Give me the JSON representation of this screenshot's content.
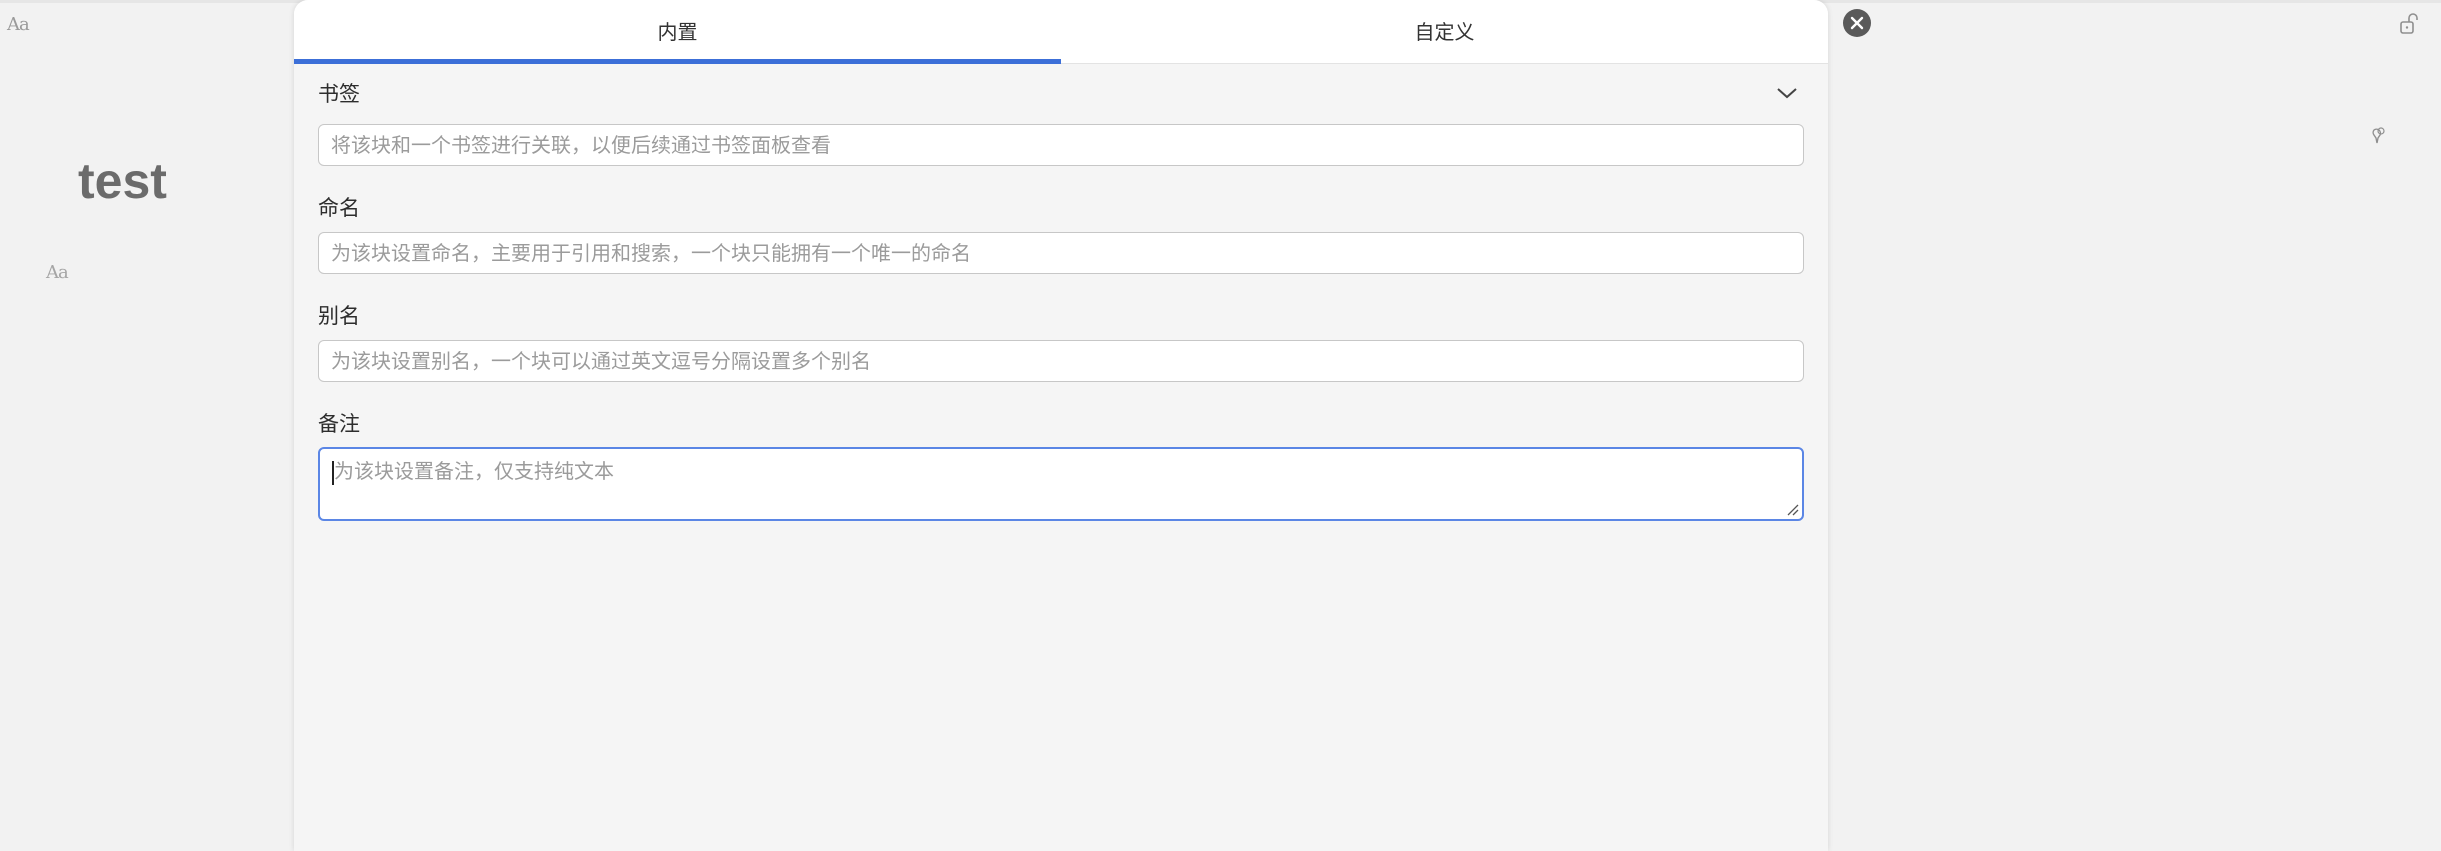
{
  "editor": {
    "title": "test",
    "font_icon_label": "Aa"
  },
  "dialog": {
    "tabs": [
      {
        "label": "内置",
        "active": true
      },
      {
        "label": "自定义",
        "active": false
      }
    ],
    "fields": {
      "bookmark": {
        "label": "书签",
        "placeholder": "将该块和一个书签进行关联，以便后续通过书签面板查看",
        "value": ""
      },
      "name": {
        "label": "命名",
        "placeholder": "为该块设置命名，主要用于引用和搜索，一个块只能拥有一个唯一的命名",
        "value": ""
      },
      "alias": {
        "label": "别名",
        "placeholder": "为该块设置别名，一个块可以通过英文逗号分隔设置多个别名",
        "value": ""
      },
      "memo": {
        "label": "备注",
        "placeholder": "为该块设置备注，仅支持纯文本",
        "value": ""
      }
    }
  },
  "colors": {
    "accent": "#3c6fd8",
    "focus_border": "#5b86e5",
    "dialog_bg": "#f5f5f5",
    "page_bg": "#f2f2f2"
  },
  "icons": {
    "close": "close-icon",
    "chevron": "chevron-down-icon",
    "lock": "lock-open-icon",
    "pin": "pin-icon",
    "font": "font-size-icon"
  }
}
